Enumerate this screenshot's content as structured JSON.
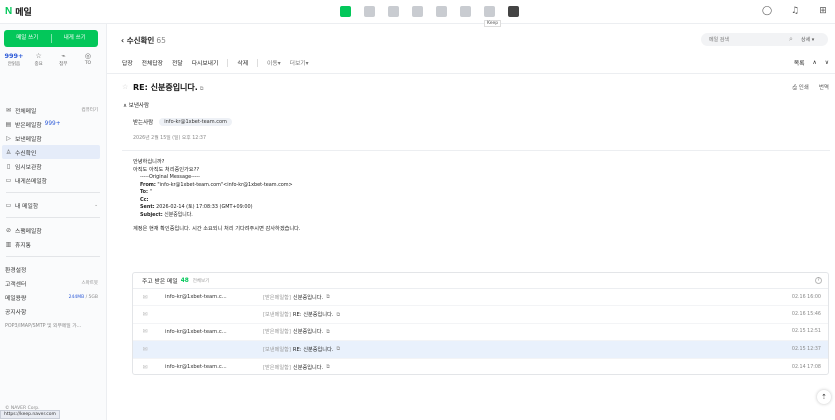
{
  "logo": {
    "brand": "N",
    "title": "메일"
  },
  "topbar": {
    "tooltip": "Keep"
  },
  "sidebar": {
    "compose": "메일 쓰기",
    "self": "내게 쓰기",
    "quick": [
      {
        "value": "999+",
        "label": "안읽음"
      },
      {
        "value": "☆",
        "label": "중요"
      },
      {
        "value": "⌁",
        "label": "첨부"
      },
      {
        "value": "◎",
        "label": "TO"
      }
    ],
    "items": [
      {
        "label": "전체메일",
        "right": "컴퓨터기"
      },
      {
        "label": "받은메일함",
        "count": "999+"
      },
      {
        "label": "보낸메일함"
      },
      {
        "label": "수신확인"
      },
      {
        "label": "임시보관함"
      },
      {
        "label": "내게쓴메일함"
      },
      {
        "label": "내 메일함"
      },
      {
        "label": "스팸메일함"
      },
      {
        "label": "휴지통"
      },
      {
        "label": "환경설정"
      },
      {
        "label": "고객센터",
        "right": "스마트봇"
      },
      {
        "label": "메일용량",
        "usage": "244MB",
        "total": " / 5GB"
      },
      {
        "label": "공지사항"
      },
      {
        "label": "POP3/IMAP/SMTP 및 외부메일 가..."
      }
    ],
    "footer": "© NAVER Corp.",
    "status_url": "https://keep.naver.com"
  },
  "main": {
    "header_title": "수신확인",
    "header_count": "65",
    "search_placeholder": "메일 검색",
    "search_detail": "상세",
    "toolbar": [
      "답장",
      "전체답장",
      "전달",
      "다시보내기",
      "삭제",
      "이동",
      "더보기"
    ],
    "toolbar_right": "목록",
    "subject": "RE: 신분중입니다.",
    "print": "인쇄",
    "translate": "번역",
    "sender_toggle": "보낸사람",
    "recipient_label": "받는사람",
    "recipient": "info-kr@1xbet-team.com",
    "date": "2026년 2월 15일 (일) 오후 12:37",
    "body": {
      "line1": "안녕하십니까?",
      "line2": "아직도 아직도 처리중인가요??",
      "orig": "-----Original Message-----",
      "from_k": "From:",
      "from_v": " \"info-kr@1xbet-team.com\"<info-kr@1xbet-team.com>",
      "to_k": "To:",
      "to_v": " \"",
      "cc_k": "Cc:",
      "sent_k": "Sent:",
      "sent_v": " 2026-02-14 (토) 17:08:33 (GMT+09:00)",
      "subject_k": "Subject:",
      "subject_v": " 신분중입니다.",
      "reply": "계정은 현재 확인중입니다. 시간 소요되니 처리 기다려주시면 감사하겠습니다."
    },
    "related": {
      "title": "주고 받은 메일",
      "count": "48",
      "all": "전체보기",
      "rows": [
        {
          "from": "info-kr@1xbet-team.c...",
          "tag": "[받은메일함]",
          "title": "신분중입니다.",
          "time": "02.16 16:00"
        },
        {
          "from": "",
          "tag": "[보낸메일함]",
          "title": "RE: 신분중입니다.",
          "time": "02.16 15:46"
        },
        {
          "from": "info-kr@1xbet-team.c...",
          "tag": "[받은메일함]",
          "title": "신분중입니다.",
          "time": "02.15 12:51"
        },
        {
          "from": "",
          "tag": "[보낸메일함]",
          "title": "RE: 신분중입니다.",
          "time": "02.15 12:37"
        },
        {
          "from": "info-kr@1xbet-team.c...",
          "tag": "[받은메일함]",
          "title": "신분중입니다.",
          "time": "02.14 17:08"
        }
      ]
    }
  }
}
